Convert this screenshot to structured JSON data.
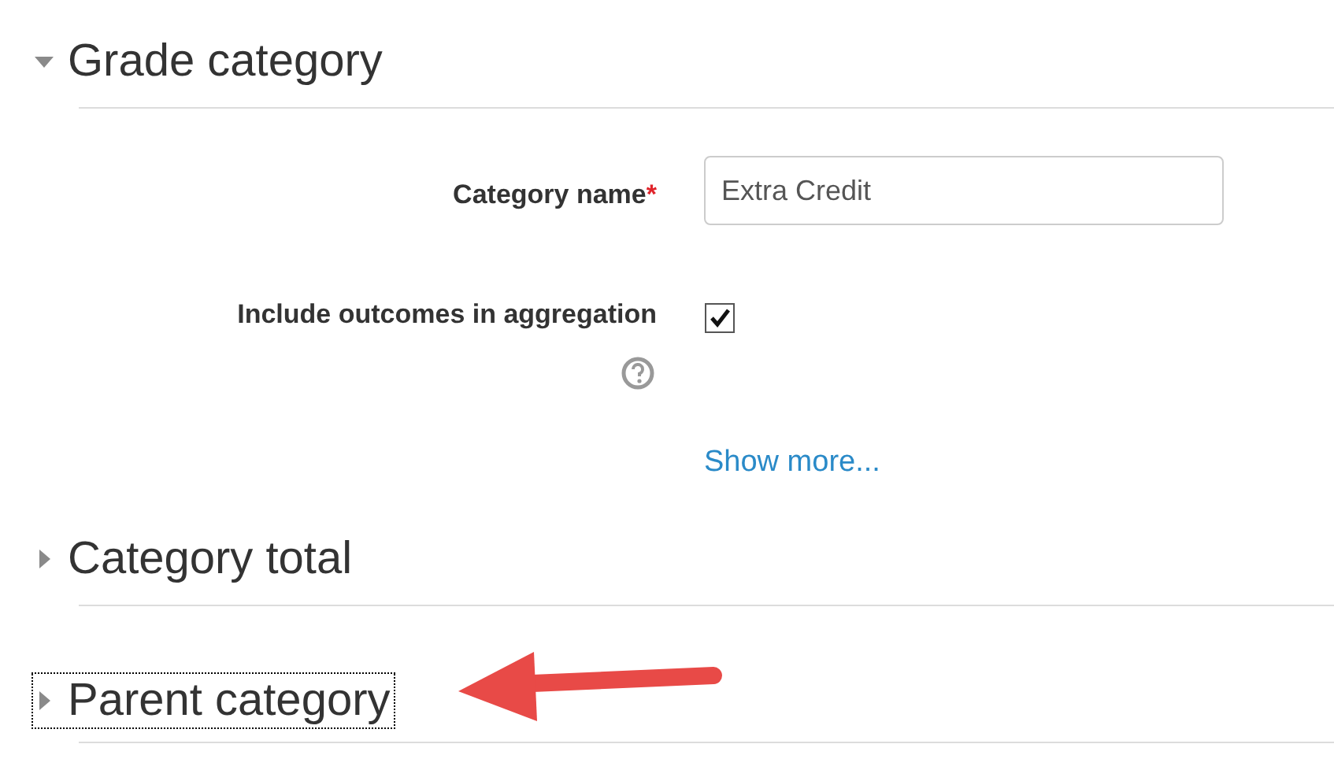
{
  "sections": [
    {
      "title": "Grade category",
      "expanded": true,
      "focused": false,
      "fields": [
        {
          "kind": "text",
          "label": "Category name",
          "required": true,
          "required_mark": "*",
          "value": "Extra Credit"
        },
        {
          "kind": "checkbox",
          "label": "Include outcomes in aggregation",
          "checked": true,
          "help": true
        }
      ],
      "show_more": "Show more..."
    },
    {
      "title": "Category total",
      "expanded": false,
      "focused": false
    },
    {
      "title": "Parent category",
      "expanded": false,
      "focused": true
    }
  ]
}
